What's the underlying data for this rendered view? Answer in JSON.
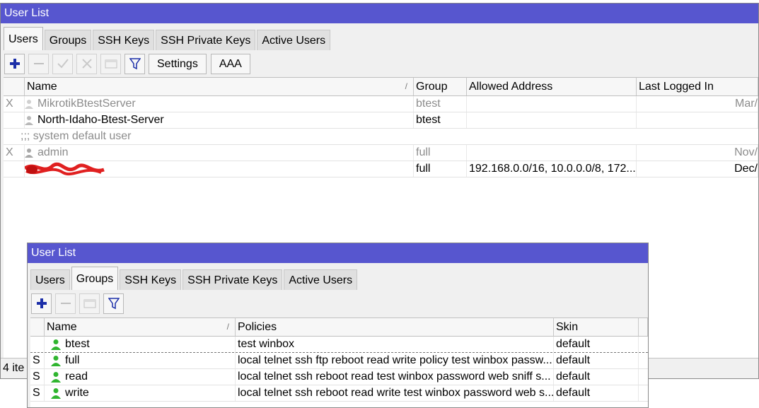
{
  "win1": {
    "title": "User List",
    "tabs": [
      "Users",
      "Groups",
      "SSH Keys",
      "SSH Private Keys",
      "Active Users"
    ],
    "active_tab": "Users",
    "toolbar": {
      "settings_label": "Settings",
      "aaa_label": "AAA"
    },
    "columns": [
      "Name",
      "Group",
      "Allowed Address",
      "Last Logged In"
    ],
    "rows": [
      {
        "flag": "X",
        "name": "MikrotikBtestServer",
        "group": "btest",
        "address": "",
        "last": "Mar/",
        "disabled": true
      },
      {
        "flag": "",
        "name": "North-Idaho-Btest-Server",
        "group": "btest",
        "address": "",
        "last": "",
        "disabled": false
      },
      {
        "comment": ";;; system default user"
      },
      {
        "flag": "X",
        "name": "admin",
        "group": "full",
        "address": "",
        "last": "Nov/",
        "disabled": true
      },
      {
        "flag": "",
        "name": "",
        "group": "full",
        "address": "192.168.0.0/16, 10.0.0.0/8, 172....",
        "last": "Dec/",
        "disabled": false,
        "redacted": true
      }
    ],
    "status": "4 ite"
  },
  "win2": {
    "title": "User List",
    "tabs": [
      "Users",
      "Groups",
      "SSH Keys",
      "SSH Private Keys",
      "Active Users"
    ],
    "active_tab": "Groups",
    "columns": [
      "Name",
      "Policies",
      "Skin"
    ],
    "rows": [
      {
        "flag": "",
        "name": "btest",
        "policies": "test winbox",
        "skin": "default"
      },
      {
        "flag": "S",
        "name": "full",
        "policies": "local telnet ssh ftp reboot read write policy test winbox passw...",
        "skin": "default"
      },
      {
        "flag": "S",
        "name": "read",
        "policies": "local telnet ssh reboot read test winbox password web sniff s...",
        "skin": "default"
      },
      {
        "flag": "S",
        "name": "write",
        "policies": "local telnet ssh reboot read write test winbox password web s...",
        "skin": "default"
      }
    ]
  },
  "colors": {
    "titlebar": "#5756cf",
    "accent_blue": "#1c2fa8",
    "group_icon_green": "#2fb52f",
    "redaction_red": "#e02020"
  }
}
